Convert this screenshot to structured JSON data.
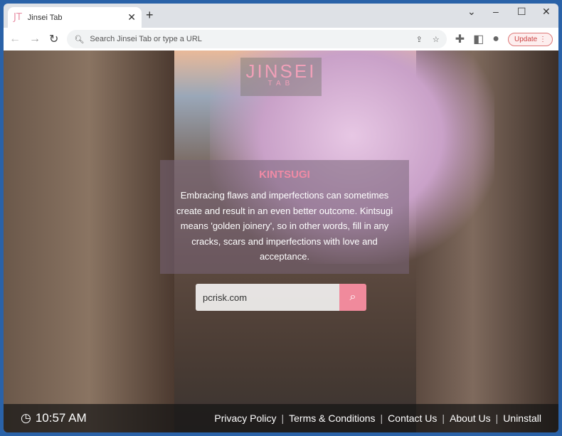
{
  "browser": {
    "tab_title": "Jinsei Tab",
    "tab_logo": "JT",
    "address_placeholder": "Search Jinsei Tab or type a URL",
    "update_label": "Update"
  },
  "brand": {
    "name": "JINSEI",
    "sub": "TAB"
  },
  "quote": {
    "title": "KINTSUGI",
    "text": "Embracing flaws and imperfections can sometimes create and result in an even better outcome. Kintsugi means 'golden joinery', so in other words, fill in any cracks, scars and imperfections with love and acceptance."
  },
  "search": {
    "value": "pcrisk.com"
  },
  "footer": {
    "time": "10:57 AM",
    "links": [
      "Privacy Policy",
      "Terms & Conditions",
      "Contact Us",
      "About Us",
      "Uninstall"
    ]
  },
  "colors": {
    "accent": "#f08a9c",
    "frame": "#2a62a8"
  }
}
